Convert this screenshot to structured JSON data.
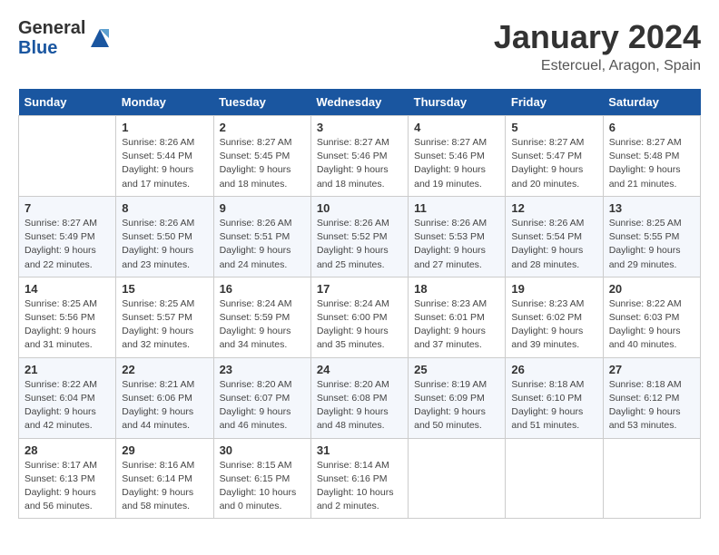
{
  "header": {
    "logo_line1": "General",
    "logo_line2": "Blue",
    "title": "January 2024",
    "subtitle": "Estercuel, Aragon, Spain"
  },
  "columns": [
    "Sunday",
    "Monday",
    "Tuesday",
    "Wednesday",
    "Thursday",
    "Friday",
    "Saturday"
  ],
  "weeks": [
    [
      {
        "day": "",
        "info": ""
      },
      {
        "day": "1",
        "info": "Sunrise: 8:26 AM\nSunset: 5:44 PM\nDaylight: 9 hours\nand 17 minutes."
      },
      {
        "day": "2",
        "info": "Sunrise: 8:27 AM\nSunset: 5:45 PM\nDaylight: 9 hours\nand 18 minutes."
      },
      {
        "day": "3",
        "info": "Sunrise: 8:27 AM\nSunset: 5:46 PM\nDaylight: 9 hours\nand 18 minutes."
      },
      {
        "day": "4",
        "info": "Sunrise: 8:27 AM\nSunset: 5:46 PM\nDaylight: 9 hours\nand 19 minutes."
      },
      {
        "day": "5",
        "info": "Sunrise: 8:27 AM\nSunset: 5:47 PM\nDaylight: 9 hours\nand 20 minutes."
      },
      {
        "day": "6",
        "info": "Sunrise: 8:27 AM\nSunset: 5:48 PM\nDaylight: 9 hours\nand 21 minutes."
      }
    ],
    [
      {
        "day": "7",
        "info": "Sunrise: 8:27 AM\nSunset: 5:49 PM\nDaylight: 9 hours\nand 22 minutes."
      },
      {
        "day": "8",
        "info": "Sunrise: 8:26 AM\nSunset: 5:50 PM\nDaylight: 9 hours\nand 23 minutes."
      },
      {
        "day": "9",
        "info": "Sunrise: 8:26 AM\nSunset: 5:51 PM\nDaylight: 9 hours\nand 24 minutes."
      },
      {
        "day": "10",
        "info": "Sunrise: 8:26 AM\nSunset: 5:52 PM\nDaylight: 9 hours\nand 25 minutes."
      },
      {
        "day": "11",
        "info": "Sunrise: 8:26 AM\nSunset: 5:53 PM\nDaylight: 9 hours\nand 27 minutes."
      },
      {
        "day": "12",
        "info": "Sunrise: 8:26 AM\nSunset: 5:54 PM\nDaylight: 9 hours\nand 28 minutes."
      },
      {
        "day": "13",
        "info": "Sunrise: 8:25 AM\nSunset: 5:55 PM\nDaylight: 9 hours\nand 29 minutes."
      }
    ],
    [
      {
        "day": "14",
        "info": "Sunrise: 8:25 AM\nSunset: 5:56 PM\nDaylight: 9 hours\nand 31 minutes."
      },
      {
        "day": "15",
        "info": "Sunrise: 8:25 AM\nSunset: 5:57 PM\nDaylight: 9 hours\nand 32 minutes."
      },
      {
        "day": "16",
        "info": "Sunrise: 8:24 AM\nSunset: 5:59 PM\nDaylight: 9 hours\nand 34 minutes."
      },
      {
        "day": "17",
        "info": "Sunrise: 8:24 AM\nSunset: 6:00 PM\nDaylight: 9 hours\nand 35 minutes."
      },
      {
        "day": "18",
        "info": "Sunrise: 8:23 AM\nSunset: 6:01 PM\nDaylight: 9 hours\nand 37 minutes."
      },
      {
        "day": "19",
        "info": "Sunrise: 8:23 AM\nSunset: 6:02 PM\nDaylight: 9 hours\nand 39 minutes."
      },
      {
        "day": "20",
        "info": "Sunrise: 8:22 AM\nSunset: 6:03 PM\nDaylight: 9 hours\nand 40 minutes."
      }
    ],
    [
      {
        "day": "21",
        "info": "Sunrise: 8:22 AM\nSunset: 6:04 PM\nDaylight: 9 hours\nand 42 minutes."
      },
      {
        "day": "22",
        "info": "Sunrise: 8:21 AM\nSunset: 6:06 PM\nDaylight: 9 hours\nand 44 minutes."
      },
      {
        "day": "23",
        "info": "Sunrise: 8:20 AM\nSunset: 6:07 PM\nDaylight: 9 hours\nand 46 minutes."
      },
      {
        "day": "24",
        "info": "Sunrise: 8:20 AM\nSunset: 6:08 PM\nDaylight: 9 hours\nand 48 minutes."
      },
      {
        "day": "25",
        "info": "Sunrise: 8:19 AM\nSunset: 6:09 PM\nDaylight: 9 hours\nand 50 minutes."
      },
      {
        "day": "26",
        "info": "Sunrise: 8:18 AM\nSunset: 6:10 PM\nDaylight: 9 hours\nand 51 minutes."
      },
      {
        "day": "27",
        "info": "Sunrise: 8:18 AM\nSunset: 6:12 PM\nDaylight: 9 hours\nand 53 minutes."
      }
    ],
    [
      {
        "day": "28",
        "info": "Sunrise: 8:17 AM\nSunset: 6:13 PM\nDaylight: 9 hours\nand 56 minutes."
      },
      {
        "day": "29",
        "info": "Sunrise: 8:16 AM\nSunset: 6:14 PM\nDaylight: 9 hours\nand 58 minutes."
      },
      {
        "day": "30",
        "info": "Sunrise: 8:15 AM\nSunset: 6:15 PM\nDaylight: 10 hours\nand 0 minutes."
      },
      {
        "day": "31",
        "info": "Sunrise: 8:14 AM\nSunset: 6:16 PM\nDaylight: 10 hours\nand 2 minutes."
      },
      {
        "day": "",
        "info": ""
      },
      {
        "day": "",
        "info": ""
      },
      {
        "day": "",
        "info": ""
      }
    ]
  ]
}
